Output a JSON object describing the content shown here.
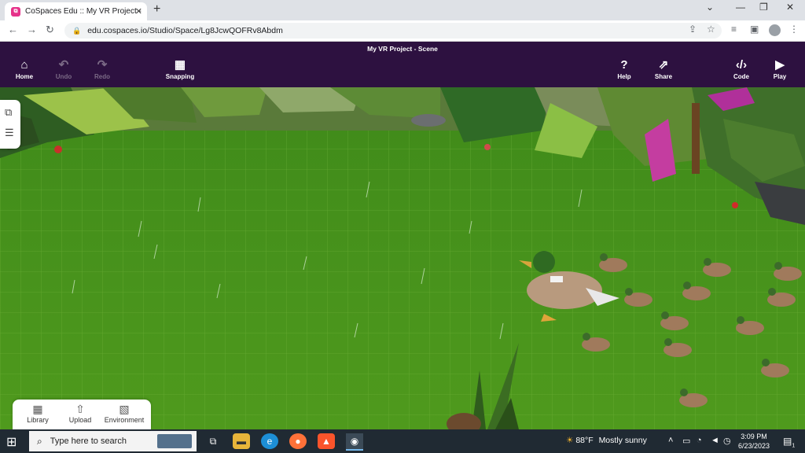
{
  "browser": {
    "tab_title": "CoSpaces Edu :: My VR Project -",
    "tab_favicon": "cospaces-logo-icon",
    "url": "edu.cospaces.io/Studio/Space/Lg8JcwQOFRv8Abdm"
  },
  "app": {
    "scene_title": "My VR Project - Scene",
    "toolbar": {
      "home": "Home",
      "undo": "Undo",
      "redo": "Redo",
      "snapping": "Snapping",
      "help": "Help",
      "share": "Share",
      "code": "Code",
      "play": "Play"
    },
    "bottom_panel": {
      "library": "Library",
      "upload": "Upload",
      "environment": "Environment"
    }
  },
  "taskbar": {
    "search_placeholder": "Type here to search",
    "weather_temp": "88°F",
    "weather_text": "Mostly sunny",
    "time": "3:09 PM",
    "date": "6/23/2023",
    "notification_count": "1"
  },
  "colors": {
    "toolbar_bg": "#2d1140",
    "ground": "#4f9a1d",
    "taskbar_bg": "#202a33",
    "accent_pink": "#e6328a"
  }
}
